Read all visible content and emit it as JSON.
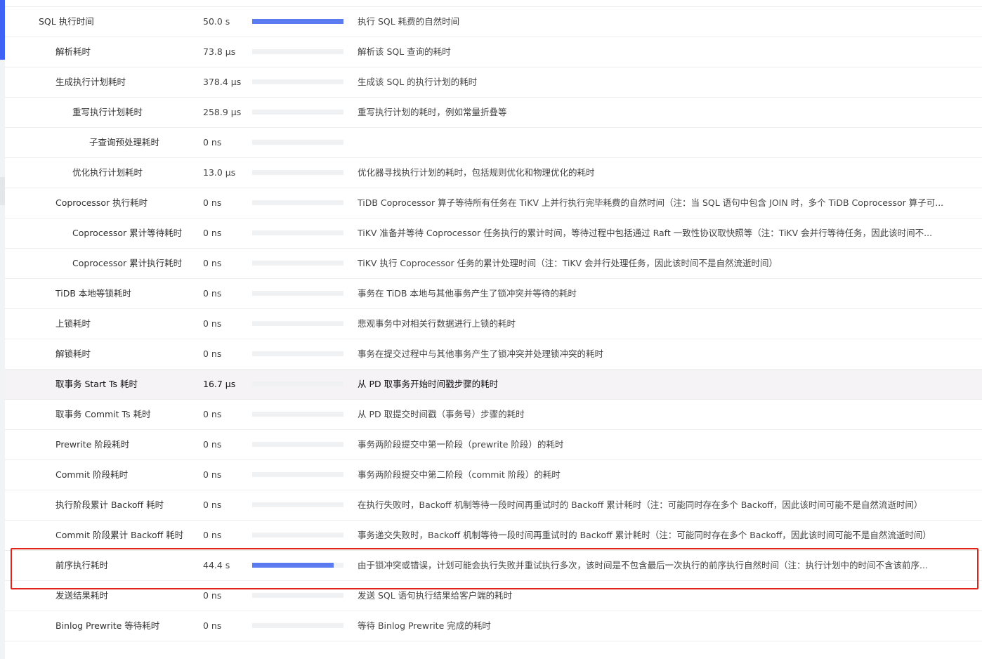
{
  "rows": [
    {
      "name": "SQL 执行时间",
      "value": "50.0 s",
      "fraction": 1.0,
      "desc": "执行 SQL 耗费的自然时间",
      "level": 0
    },
    {
      "name": "解析耗时",
      "value": "73.8 μs",
      "fraction": 0.0,
      "desc": "解析该 SQL 查询的耗时",
      "level": 1
    },
    {
      "name": "生成执行计划耗时",
      "value": "378.4 μs",
      "fraction": 0.0,
      "desc": "生成该 SQL 的执行计划的耗时",
      "level": 1
    },
    {
      "name": "重写执行计划耗时",
      "value": "258.9 μs",
      "fraction": 0.0,
      "desc": "重写执行计划的耗时，例如常量折叠等",
      "level": 2
    },
    {
      "name": "子查询预处理耗时",
      "value": "0 ns",
      "fraction": 0.0,
      "desc": "",
      "level": 3
    },
    {
      "name": "优化执行计划耗时",
      "value": "13.0 μs",
      "fraction": 0.0,
      "desc": "优化器寻找执行计划的耗时，包括规则优化和物理优化的耗时",
      "level": 2
    },
    {
      "name": "Coprocessor 执行耗时",
      "value": "0 ns",
      "fraction": 0.0,
      "desc": "TiDB Coprocessor 算子等待所有任务在 TiKV 上并行执行完毕耗费的自然时间（注：当 SQL 语句中包含 JOIN 时，多个 TiDB Coprocessor 算子可...",
      "level": 1
    },
    {
      "name": "Coprocessor 累计等待耗时",
      "value": "0 ns",
      "fraction": 0.0,
      "desc": "TiKV 准备并等待 Coprocessor 任务执行的累计时间，等待过程中包括通过 Raft 一致性协议取快照等（注：TiKV 会并行等待任务，因此该时间不...",
      "level": 2
    },
    {
      "name": "Coprocessor 累计执行耗时",
      "value": "0 ns",
      "fraction": 0.0,
      "desc": "TiKV 执行 Coprocessor 任务的累计处理时间（注：TiKV 会并行处理任务，因此该时间不是自然流逝时间）",
      "level": 2
    },
    {
      "name": "TiDB 本地等锁耗时",
      "value": "0 ns",
      "fraction": 0.0,
      "desc": "事务在 TiDB 本地与其他事务产生了锁冲突并等待的耗时",
      "level": 1
    },
    {
      "name": "上锁耗时",
      "value": "0 ns",
      "fraction": 0.0,
      "desc": "悲观事务中对相关行数据进行上锁的耗时",
      "level": 1
    },
    {
      "name": "解锁耗时",
      "value": "0 ns",
      "fraction": 0.0,
      "desc": "事务在提交过程中与其他事务产生了锁冲突并处理锁冲突的耗时",
      "level": 1
    },
    {
      "name": "取事务 Start Ts 耗时",
      "value": "16.7 μs",
      "fraction": 0.0,
      "desc": "从 PD 取事务开始时间戳步骤的耗时",
      "level": 1
    },
    {
      "name": "取事务 Commit Ts 耗时",
      "value": "0 ns",
      "fraction": 0.0,
      "desc": "从 PD 取提交时间戳（事务号）步骤的耗时",
      "level": 1
    },
    {
      "name": "Prewrite 阶段耗时",
      "value": "0 ns",
      "fraction": 0.0,
      "desc": "事务两阶段提交中第一阶段（prewrite 阶段）的耗时",
      "level": 1
    },
    {
      "name": "Commit 阶段耗时",
      "value": "0 ns",
      "fraction": 0.0,
      "desc": "事务两阶段提交中第二阶段（commit 阶段）的耗时",
      "level": 1
    },
    {
      "name": "执行阶段累计 Backoff 耗时",
      "value": "0 ns",
      "fraction": 0.0,
      "desc": "在执行失败时，Backoff 机制等待一段时间再重试时的 Backoff 累计耗时（注：可能同时存在多个 Backoff，因此该时间可能不是自然流逝时间）",
      "level": 1
    },
    {
      "name": "Commit 阶段累计 Backoff 耗时",
      "value": "0 ns",
      "fraction": 0.0,
      "desc": "事务递交失败时，Backoff 机制等待一段时间再重试时的 Backoff 累计耗时（注：可能同时存在多个 Backoff，因此该时间可能不是自然流逝时间）",
      "level": 1
    },
    {
      "name": "前序执行耗时",
      "value": "44.4 s",
      "fraction": 0.89,
      "desc": "由于锁冲突或错误，计划可能会执行失败并重试执行多次，该时间是不包含最后一次执行的前序执行自然时间（注：执行计划中的时间不含该前序...",
      "level": 1
    },
    {
      "name": "发送结果耗时",
      "value": "0 ns",
      "fraction": 0.0,
      "desc": "发送 SQL 语句执行结果给客户端的耗时",
      "level": 1
    },
    {
      "name": "Binlog Prewrite 等待耗时",
      "value": "0 ns",
      "fraction": 0.0,
      "desc": "等待 Binlog Prewrite 完成的耗时",
      "level": 1
    }
  ],
  "highlighted_row_index": 12,
  "boxed_row_index": 18,
  "colors": {
    "bar_fill": "#5b7bf1",
    "bar_track": "#f0f1f3",
    "accent": "#3f64f5",
    "highlight_row": "#f6f3f6",
    "annotation_box": "#e2231a"
  }
}
